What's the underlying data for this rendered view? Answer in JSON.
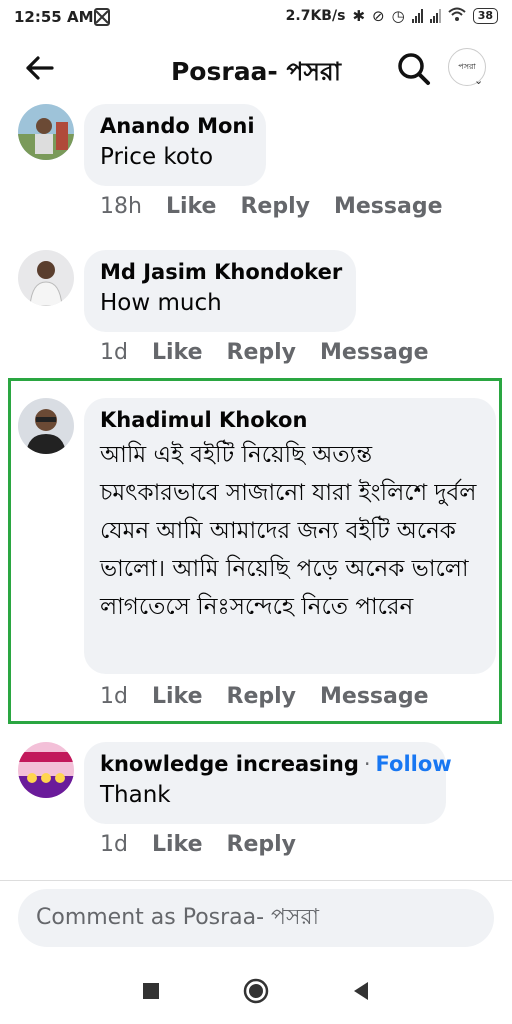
{
  "status": {
    "time": "12:55 AM",
    "speed": "2.7KB/s",
    "battery": "38"
  },
  "header": {
    "title": "Posraa- পসরা",
    "avatar_text": "পসরা"
  },
  "comments": [
    {
      "name": "Anando Moni",
      "text": "Price koto",
      "age": "18h",
      "like": "Like",
      "reply": "Reply",
      "message": "Message"
    },
    {
      "name": "Md Jasim Khondoker",
      "text": "How much",
      "age": "1d",
      "like": "Like",
      "reply": "Reply",
      "message": "Message"
    },
    {
      "name": "Khadimul Khokon",
      "text": "আমি এই বইটি নিয়েছি অত্যন্ত চমৎকারভাবে সাজানো যারা ইংলিশে দুর্বল যেমন আমি  আমাদের জন্য বইটি অনেক ভালো। আমি নিয়েছি পড়ে অনেক ভালো লাগতেসে নিঃসন্দেহে নিতে পারেন",
      "age": "1d",
      "like": "Like",
      "reply": "Reply",
      "message": "Message"
    },
    {
      "name": "knowledge increasing",
      "follow": "Follow",
      "text": "Thank",
      "age": "1d",
      "like": "Like",
      "reply": "Reply"
    }
  ],
  "composer": {
    "placeholder": "Comment as Posraa- পসরা"
  },
  "colors": {
    "accent": "#1877f2",
    "highlight": "#2aa641",
    "bubble": "#f0f2f5",
    "meta": "#65676b"
  }
}
